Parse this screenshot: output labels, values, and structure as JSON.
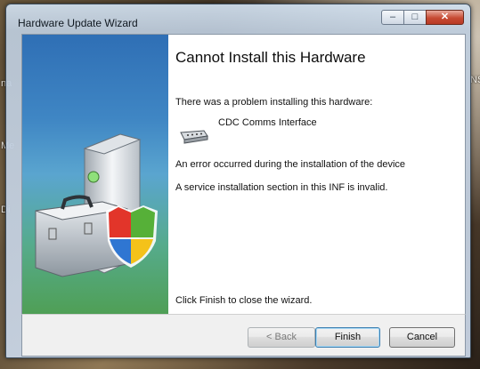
{
  "window": {
    "title": "Hardware Update Wizard"
  },
  "page": {
    "heading": "Cannot Install this Hardware",
    "intro": "There was a problem installing this hardware:",
    "device_name": "CDC Comms Interface",
    "error_line1": "An error occurred during the installation of the device",
    "error_line2": "A service installation section in this INF is invalid.",
    "close_hint": "Click Finish to close the wizard."
  },
  "buttons": {
    "back": "< Back",
    "finish": "Finish",
    "cancel": "Cancel"
  },
  "background_fragments": {
    "left_1": "na",
    "left_2": "Me",
    "left_3": "Di",
    "right_1": "NS"
  },
  "icons": {
    "device": "serial-port-icon",
    "sidebar": "toolbox-shield-icon"
  }
}
